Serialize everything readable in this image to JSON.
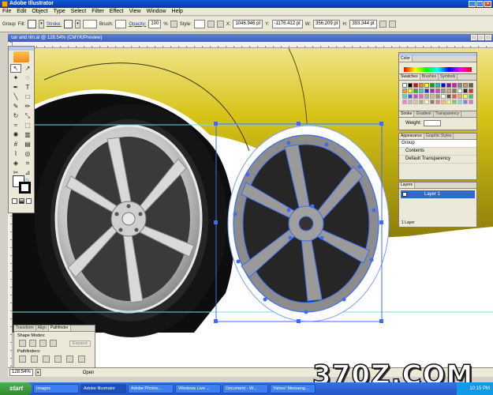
{
  "window": {
    "title": "Adobe Illustrator"
  },
  "menu": [
    "File",
    "Edit",
    "Object",
    "Type",
    "Select",
    "Filter",
    "Effect",
    "View",
    "Window",
    "Help"
  ],
  "control_bar": {
    "selection_label": "Group",
    "fill_label": "Fill:",
    "stroke_label": "Stroke:",
    "brush_label": "Brush:",
    "opacity_label": "Opacity:",
    "opacity_value": "100",
    "opacity_unit": "%",
    "style_label": "Style:",
    "x_label": "X:",
    "x_value": "1046.946 pt",
    "y_label": "Y:",
    "y_value": "-1176.412 pt",
    "w_label": "W:",
    "w_value": "356.209 pt",
    "h_label": "H:",
    "h_value": "393.344 pt"
  },
  "document": {
    "title": "car and rim.ai @ 128.54% (CMYK/Preview)"
  },
  "panels": {
    "color": {
      "tabs": [
        "Color"
      ]
    },
    "swatches": {
      "tabs": [
        "Swatches",
        "Brushes",
        "Symbols"
      ]
    },
    "stroke": {
      "tabs": [
        "Stroke",
        "Gradient",
        "Transparency"
      ],
      "weight_label": "Weight:"
    },
    "appearance": {
      "tabs": [
        "Appearance",
        "Graphic Styles"
      ],
      "rows": [
        "Group",
        "Contents",
        "Default Transparency"
      ]
    },
    "layers": {
      "tabs": [
        "Layers"
      ],
      "layer_name": "Layer 1",
      "footer": "1 Layer"
    },
    "pathfinder": {
      "tabs": [
        "Transform",
        "Align",
        "Pathfinder"
      ],
      "shape_modes_label": "Shape Modes:",
      "expand_label": "Expand",
      "pathfinders_label": "Pathfinders:"
    }
  },
  "status": {
    "zoom": "128.54%",
    "open_label": "Open"
  },
  "taskbar": {
    "start_label": "start",
    "tasks": [
      "Images",
      "Adobe Illustrator",
      "Adobe Photos...",
      "Windows Live ...",
      "Document - W...",
      "Yahoo! Messeng..."
    ],
    "clock": "10:15 PM"
  },
  "watermark": "370Z.COM",
  "colors": {
    "car_body": "#d8c417",
    "tire": "#111111",
    "rim_silver": "#c9c9c9",
    "selection": "#3d6cf0",
    "guide": "#7ad7e8"
  }
}
